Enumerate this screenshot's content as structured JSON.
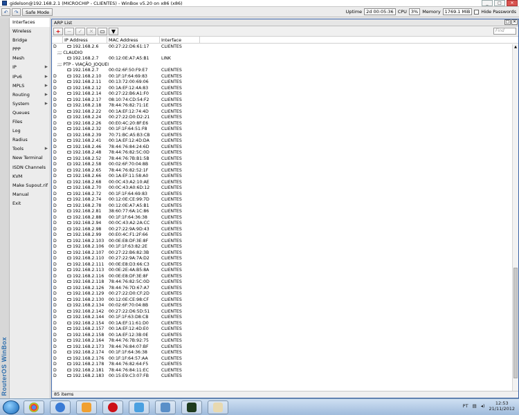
{
  "window": {
    "title": "gidelson@192.168.2.1 (MICROCHIP - CLIENTES) - WinBox v5.20 on x86 (x86)",
    "controls": [
      "_",
      "□",
      "✕"
    ]
  },
  "toolbar": {
    "safe_mode_label": "Safe Mode",
    "uptime_label": "Uptime",
    "uptime_value": "2d 00:05:36",
    "cpu_label": "CPU",
    "cpu_value": "3%",
    "memory_label": "Memory",
    "memory_value": "1769.1 MiB",
    "hide_passwords_label": "Hide Passwords"
  },
  "sidebar": {
    "banner": "RouterOS WinBox",
    "items": [
      {
        "label": "Interfaces",
        "arrow": ""
      },
      {
        "label": "Wireless",
        "arrow": ""
      },
      {
        "label": "Bridge",
        "arrow": ""
      },
      {
        "label": "PPP",
        "arrow": ""
      },
      {
        "label": "Mesh",
        "arrow": ""
      },
      {
        "label": "IP",
        "arrow": "▶"
      },
      {
        "label": "IPv6",
        "arrow": "▶"
      },
      {
        "label": "MPLS",
        "arrow": "▶"
      },
      {
        "label": "Routing",
        "arrow": "▶"
      },
      {
        "label": "System",
        "arrow": "▶"
      },
      {
        "label": "Queues",
        "arrow": ""
      },
      {
        "label": "Files",
        "arrow": ""
      },
      {
        "label": "Log",
        "arrow": ""
      },
      {
        "label": "Radius",
        "arrow": ""
      },
      {
        "label": "Tools",
        "arrow": "▶"
      },
      {
        "label": "New Terminal",
        "arrow": ""
      },
      {
        "label": "ISDN Channels",
        "arrow": ""
      },
      {
        "label": "KVM",
        "arrow": ""
      },
      {
        "label": "Make Supout.rif",
        "arrow": ""
      },
      {
        "label": "Manual",
        "arrow": ""
      },
      {
        "label": "Exit",
        "arrow": ""
      }
    ]
  },
  "arp": {
    "title": "ARP List",
    "find_placeholder": "Find",
    "columns": [
      "",
      "IP Address",
      "MAC Address",
      "Interface"
    ],
    "status": "85 items",
    "rows": [
      {
        "kind": "row",
        "flag": "D",
        "ip": "192.168.2.6",
        "mac": "00:27:22:D6:61:17",
        "iface": "CLIENTES"
      },
      {
        "kind": "group",
        "label": ";;; CLAUDIO"
      },
      {
        "kind": "row",
        "flag": "",
        "ip": "192.168.2.7",
        "mac": "00:12:0E:A7:A5:B1",
        "iface": "LINK"
      },
      {
        "kind": "group",
        "label": ";;; PTP - VIAÇÃO_JOQUEI"
      },
      {
        "kind": "row",
        "flag": "",
        "ip": "192.168.2.7",
        "mac": "00:02:6F:50:F9:E7",
        "iface": "CLIENTES"
      },
      {
        "kind": "row",
        "flag": "D",
        "ip": "192.168.2.10",
        "mac": "00:1F:1F:64:69:83",
        "iface": "CLIENTES"
      },
      {
        "kind": "row",
        "flag": "D",
        "ip": "192.168.2.11",
        "mac": "00:13:72:00:69:06",
        "iface": "CLIENTES"
      },
      {
        "kind": "row",
        "flag": "D",
        "ip": "192.168.2.12",
        "mac": "00:1A:EF:12:4A:83",
        "iface": "CLIENTES"
      },
      {
        "kind": "row",
        "flag": "D",
        "ip": "192.168.2.14",
        "mac": "00:27:22:B6:A1:F0",
        "iface": "CLIENTES"
      },
      {
        "kind": "row",
        "flag": "D",
        "ip": "192.168.2.17",
        "mac": "08:10:74:CD:54:F2",
        "iface": "CLIENTES"
      },
      {
        "kind": "row",
        "flag": "D",
        "ip": "192.168.2.18",
        "mac": "78:44:76:82:71:1E",
        "iface": "CLIENTES"
      },
      {
        "kind": "row",
        "flag": "D",
        "ip": "192.168.2.22",
        "mac": "00:1A:EF:12:74:4D",
        "iface": "CLIENTES"
      },
      {
        "kind": "row",
        "flag": "D",
        "ip": "192.168.2.24",
        "mac": "00:27:22:D0:D2:21",
        "iface": "CLIENTES"
      },
      {
        "kind": "row",
        "flag": "D",
        "ip": "192.168.2.26",
        "mac": "00:E0:4C:20:8F:E6",
        "iface": "CLIENTES"
      },
      {
        "kind": "row",
        "flag": "D",
        "ip": "192.168.2.32",
        "mac": "00:1F:1F:64:51:F8",
        "iface": "CLIENTES"
      },
      {
        "kind": "row",
        "flag": "D",
        "ip": "192.168.2.39",
        "mac": "70:71:BC:A5:B3:CB",
        "iface": "CLIENTES"
      },
      {
        "kind": "row",
        "flag": "D",
        "ip": "192.168.2.41",
        "mac": "00:1A:EF:12:4D:DA",
        "iface": "CLIENTES"
      },
      {
        "kind": "row",
        "flag": "D",
        "ip": "192.168.2.46",
        "mac": "78:44:76:84:24:6D",
        "iface": "CLIENTES"
      },
      {
        "kind": "row",
        "flag": "D",
        "ip": "192.168.2.48",
        "mac": "78:44:76:82:5C:0D",
        "iface": "CLIENTES"
      },
      {
        "kind": "row",
        "flag": "D",
        "ip": "192.168.2.52",
        "mac": "78:44:76:7B:B1:5B",
        "iface": "CLIENTES"
      },
      {
        "kind": "row",
        "flag": "D",
        "ip": "192.168.2.58",
        "mac": "00:02:6F:70:04:8B",
        "iface": "CLIENTES"
      },
      {
        "kind": "row",
        "flag": "D",
        "ip": "192.168.2.65",
        "mac": "78:44:76:82:52:1F",
        "iface": "CLIENTES"
      },
      {
        "kind": "row",
        "flag": "D",
        "ip": "192.168.2.66",
        "mac": "00:1A:EF:11:58:A0",
        "iface": "CLIENTES"
      },
      {
        "kind": "row",
        "flag": "D",
        "ip": "192.168.2.68",
        "mac": "00:0C:43:A2:10:AE",
        "iface": "CLIENTES"
      },
      {
        "kind": "row",
        "flag": "D",
        "ip": "192.168.2.70",
        "mac": "00:0C:43:A0:6D:12",
        "iface": "CLIENTES"
      },
      {
        "kind": "row",
        "flag": "D",
        "ip": "192.168.2.72",
        "mac": "00:1F:1F:64:69:83",
        "iface": "CLIENTES"
      },
      {
        "kind": "row",
        "flag": "D",
        "ip": "192.168.2.74",
        "mac": "00:12:0E:CE:99:7D",
        "iface": "CLIENTES"
      },
      {
        "kind": "row",
        "flag": "D",
        "ip": "192.168.2.78",
        "mac": "00:12:0E:A7:A5:B1",
        "iface": "CLIENTES"
      },
      {
        "kind": "row",
        "flag": "D",
        "ip": "192.168.2.81",
        "mac": "38:60:77:6A:1C:86",
        "iface": "CLIENTES"
      },
      {
        "kind": "row",
        "flag": "D",
        "ip": "192.168.2.88",
        "mac": "00:1F:1F:64:36:38",
        "iface": "CLIENTES"
      },
      {
        "kind": "row",
        "flag": "D",
        "ip": "192.168.2.94",
        "mac": "00:0C:43:A2:2A:CC",
        "iface": "CLIENTES"
      },
      {
        "kind": "row",
        "flag": "D",
        "ip": "192.168.2.98",
        "mac": "00:27:22:9A:9D:43",
        "iface": "CLIENTES"
      },
      {
        "kind": "row",
        "flag": "D",
        "ip": "192.168.2.99",
        "mac": "00:E0:4C:F1:2F:66",
        "iface": "CLIENTES"
      },
      {
        "kind": "row",
        "flag": "D",
        "ip": "192.168.2.103",
        "mac": "00:0E:E8:DF:3E:8F",
        "iface": "CLIENTES"
      },
      {
        "kind": "row",
        "flag": "D",
        "ip": "192.168.2.106",
        "mac": "00:1F:1F:63:82:2E",
        "iface": "CLIENTES"
      },
      {
        "kind": "row",
        "flag": "D",
        "ip": "192.168.2.107",
        "mac": "00:27:22:B6:82:3B",
        "iface": "CLIENTES"
      },
      {
        "kind": "row",
        "flag": "D",
        "ip": "192.168.2.110",
        "mac": "00:27:22:9A:7A:D2",
        "iface": "CLIENTES"
      },
      {
        "kind": "row",
        "flag": "D",
        "ip": "192.168.2.111",
        "mac": "00:0E:E8:D3:66:C3",
        "iface": "CLIENTES"
      },
      {
        "kind": "row",
        "flag": "D",
        "ip": "192.168.2.113",
        "mac": "00:0E:2E:4A:B5:8A",
        "iface": "CLIENTES"
      },
      {
        "kind": "row",
        "flag": "D",
        "ip": "192.168.2.116",
        "mac": "00:0E:E8:DF:3E:8F",
        "iface": "CLIENTES"
      },
      {
        "kind": "row",
        "flag": "D",
        "ip": "192.168.2.118",
        "mac": "78:44:76:82:5C:0D",
        "iface": "CLIENTES"
      },
      {
        "kind": "row",
        "flag": "D",
        "ip": "192.168.2.126",
        "mac": "78:44:76:7D:67:A7",
        "iface": "CLIENTES"
      },
      {
        "kind": "row",
        "flag": "D",
        "ip": "192.168.2.129",
        "mac": "00:27:22:D0:CF:2D",
        "iface": "CLIENTES"
      },
      {
        "kind": "row",
        "flag": "D",
        "ip": "192.168.2.130",
        "mac": "00:12:0E:CE:98:CF",
        "iface": "CLIENTES"
      },
      {
        "kind": "row",
        "flag": "D",
        "ip": "192.168.2.134",
        "mac": "00:02:6F:70:04:8B",
        "iface": "CLIENTES"
      },
      {
        "kind": "row",
        "flag": "D",
        "ip": "192.168.2.142",
        "mac": "00:27:22:D6:5D:51",
        "iface": "CLIENTES"
      },
      {
        "kind": "row",
        "flag": "D",
        "ip": "192.168.2.144",
        "mac": "00:1F:1F:63:D8:CB",
        "iface": "CLIENTES"
      },
      {
        "kind": "row",
        "flag": "D",
        "ip": "192.168.2.154",
        "mac": "00:1A:EF:11:61:D0",
        "iface": "CLIENTES"
      },
      {
        "kind": "row",
        "flag": "D",
        "ip": "192.168.2.157",
        "mac": "00:1A:EF:12:4D:E0",
        "iface": "CLIENTES"
      },
      {
        "kind": "row",
        "flag": "D",
        "ip": "192.168.2.158",
        "mac": "00:1A:EF:12:3B:0E",
        "iface": "CLIENTES"
      },
      {
        "kind": "row",
        "flag": "D",
        "ip": "192.168.2.164",
        "mac": "78:44:76:7B:92:75",
        "iface": "CLIENTES"
      },
      {
        "kind": "row",
        "flag": "D",
        "ip": "192.168.2.173",
        "mac": "78:44:76:84:07:BF",
        "iface": "CLIENTES"
      },
      {
        "kind": "row",
        "flag": "D",
        "ip": "192.168.2.174",
        "mac": "00:1F:1F:64:36:38",
        "iface": "CLIENTES"
      },
      {
        "kind": "row",
        "flag": "D",
        "ip": "192.168.2.176",
        "mac": "00:1F:1F:64:57:AA",
        "iface": "CLIENTES"
      },
      {
        "kind": "row",
        "flag": "D",
        "ip": "192.168.2.178",
        "mac": "78:44:76:82:64:F5",
        "iface": "CLIENTES"
      },
      {
        "kind": "row",
        "flag": "D",
        "ip": "192.168.2.181",
        "mac": "78:44:76:84:11:EC",
        "iface": "CLIENTES"
      },
      {
        "kind": "row",
        "flag": "D",
        "ip": "192.168.2.183",
        "mac": "00:15:E9:C3:07:FB",
        "iface": "CLIENTES"
      }
    ]
  },
  "taskbar": {
    "language": "PT",
    "time": "12:53",
    "date": "21/11/2012"
  },
  "colors": {
    "accent": "#2f6fae",
    "add_button": "#d40000",
    "window_border": "#3b64a8"
  }
}
